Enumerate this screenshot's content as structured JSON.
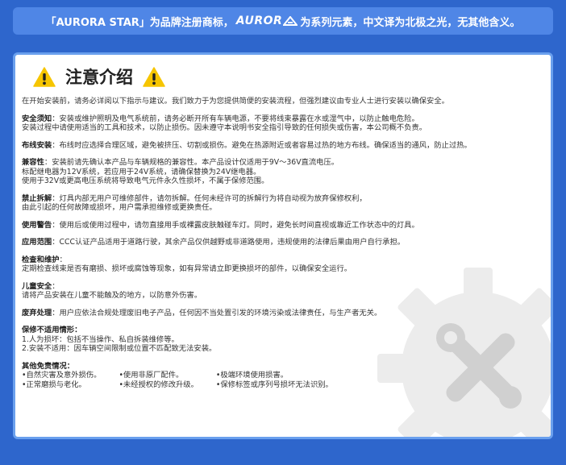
{
  "banner": {
    "prefix": "「AURORA STAR」为品牌注册商标，",
    "logo_text": "AUROR",
    "suffix": "为系列元素，中文译为北极之光，无其他含义。"
  },
  "title": "注意介绍",
  "intro": "在开始安装前，请务必详阅以下指示与建议。我们致力于为您提供简便的安装流程，但强烈建议由专业人士进行安装以确保安全。",
  "sections": {
    "install": {
      "label": "安全须知",
      "line1": "：安装或维护照明及电气系统前，请务必断开所有车辆电源，不要将线束暴露在水或湿气中，以防止触电危险。",
      "line2": "安装过程中请使用适当的工具和技术，以防止损伤。因未遵守本说明书安全指引导致的任何损失或伤害，本公司概不负责。"
    },
    "wiring": {
      "label": "布线安装",
      "text": "：布线时应选择合理区域，避免被挤压、切割或损伤。避免在热源附近或者容易过热的地方布线。确保适当的通风，防止过热。"
    },
    "compat": {
      "label": "兼容性",
      "line1": "：安装前请先确认本产品与车辆规格的兼容性。本产品设计仅适用于9V～36V直流电压。",
      "line2": "标配继电器为12V系统，若应用于24V系统，请确保替换为24V继电器。",
      "line3": "使用于32V或更高电压系统将导致电气元件永久性损坏，不属于保修范围。"
    },
    "disassembly": {
      "label": "禁止拆解",
      "line1": "：灯具内部无用户可维修部件，请勿拆解。任何未经许可的拆解行为将自动视为放弃保修权利，",
      "line2": "由此引起的任何故障或损坏，用户需承担维修或更换责任。"
    },
    "usage_warning": {
      "label": "使用警告",
      "text": "：使用后或使用过程中，请勿直接用手或裸露皮肤触碰车灯。同时，避免长时间直视或靠近工作状态中的灯具。"
    },
    "scope": {
      "label": "应用范围",
      "text": "：CCC认证产品适用于道路行驶，其余产品仅供越野或非道路使用，违规使用的法律后果由用户自行承担。"
    },
    "maintenance": {
      "label": "检查和维护",
      "colon": "：",
      "text": "定期检查线束是否有磨损、损坏或腐蚀等现象，如有异常请立即更换损坏的部件，以确保安全运行。"
    },
    "child": {
      "label": "儿童安全",
      "colon": "：",
      "text": "请将产品安装在儿童不能触及的地方，以防意外伤害。"
    },
    "disposal": {
      "label": "废弃处理",
      "text": "：用户应依法合规处理废旧电子产品，任何因不当处置引发的环境污染或法律责任，与生产者无关。"
    },
    "not_covered": {
      "label": "保修不适用情形：",
      "item1": "1.人为损坏：包括不当操作、私自拆装维修等。",
      "item2": "2.安装不适用：因车辆空间限制或位置不匹配致无法安装。"
    },
    "exemptions": {
      "label": "其他免责情况：",
      "col1": [
        "•自然灾害及意外损伤。",
        "•正常磨损与老化。"
      ],
      "col2": [
        "•使用非原厂配件。",
        "•未经授权的修改升级。"
      ],
      "col3": [
        "•极端环境使用损害。",
        "•保修标签或序列号损坏无法识别。"
      ]
    }
  }
}
